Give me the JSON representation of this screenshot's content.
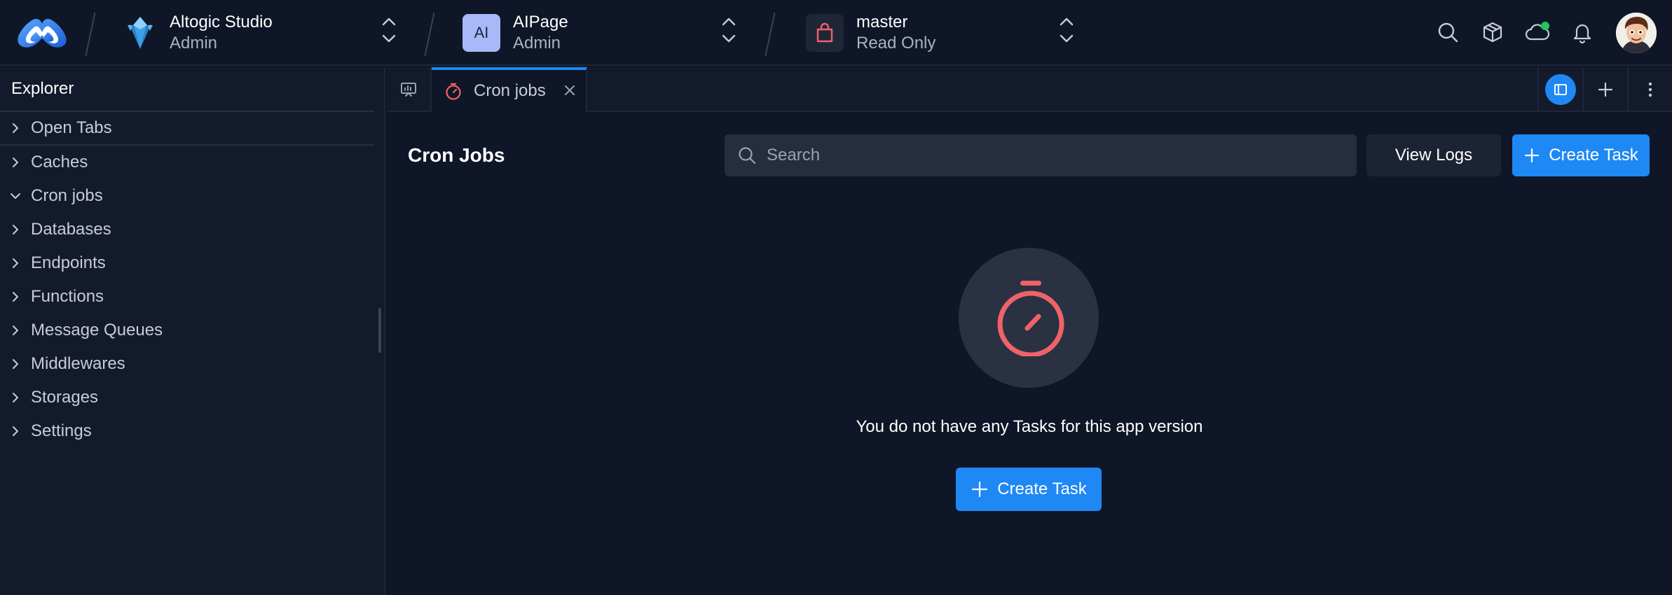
{
  "header": {
    "org": {
      "title": "Altogic Studio",
      "role": "Admin"
    },
    "app": {
      "initials": "AI",
      "title": "AIPage",
      "role": "Admin"
    },
    "env": {
      "title": "master",
      "mode": "Read Only"
    },
    "icons": [
      "search-icon",
      "package-icon",
      "cloud-icon",
      "bell-icon"
    ],
    "status_color": "#22c55e"
  },
  "sidebar": {
    "title": "Explorer",
    "items": [
      {
        "label": "Open Tabs",
        "expanded": false
      },
      {
        "label": "Caches",
        "expanded": false
      },
      {
        "label": "Cron jobs",
        "expanded": true
      },
      {
        "label": "Databases",
        "expanded": false
      },
      {
        "label": "Endpoints",
        "expanded": false
      },
      {
        "label": "Functions",
        "expanded": false
      },
      {
        "label": "Message Queues",
        "expanded": false
      },
      {
        "label": "Middlewares",
        "expanded": false
      },
      {
        "label": "Storages",
        "expanded": false
      },
      {
        "label": "Settings",
        "expanded": false
      }
    ]
  },
  "tabs": {
    "active": {
      "label": "Cron jobs",
      "icon": "stopwatch-icon"
    }
  },
  "main": {
    "title": "Cron Jobs",
    "search": {
      "placeholder": "Search",
      "value": ""
    },
    "view_logs_label": "View Logs",
    "create_task_label": "Create Task",
    "empty_message": "You do not have any Tasks for this app version",
    "empty_create_label": "Create Task"
  },
  "colors": {
    "accent": "#1e88f5",
    "timer": "#f0626a",
    "background": "#0f1628"
  }
}
